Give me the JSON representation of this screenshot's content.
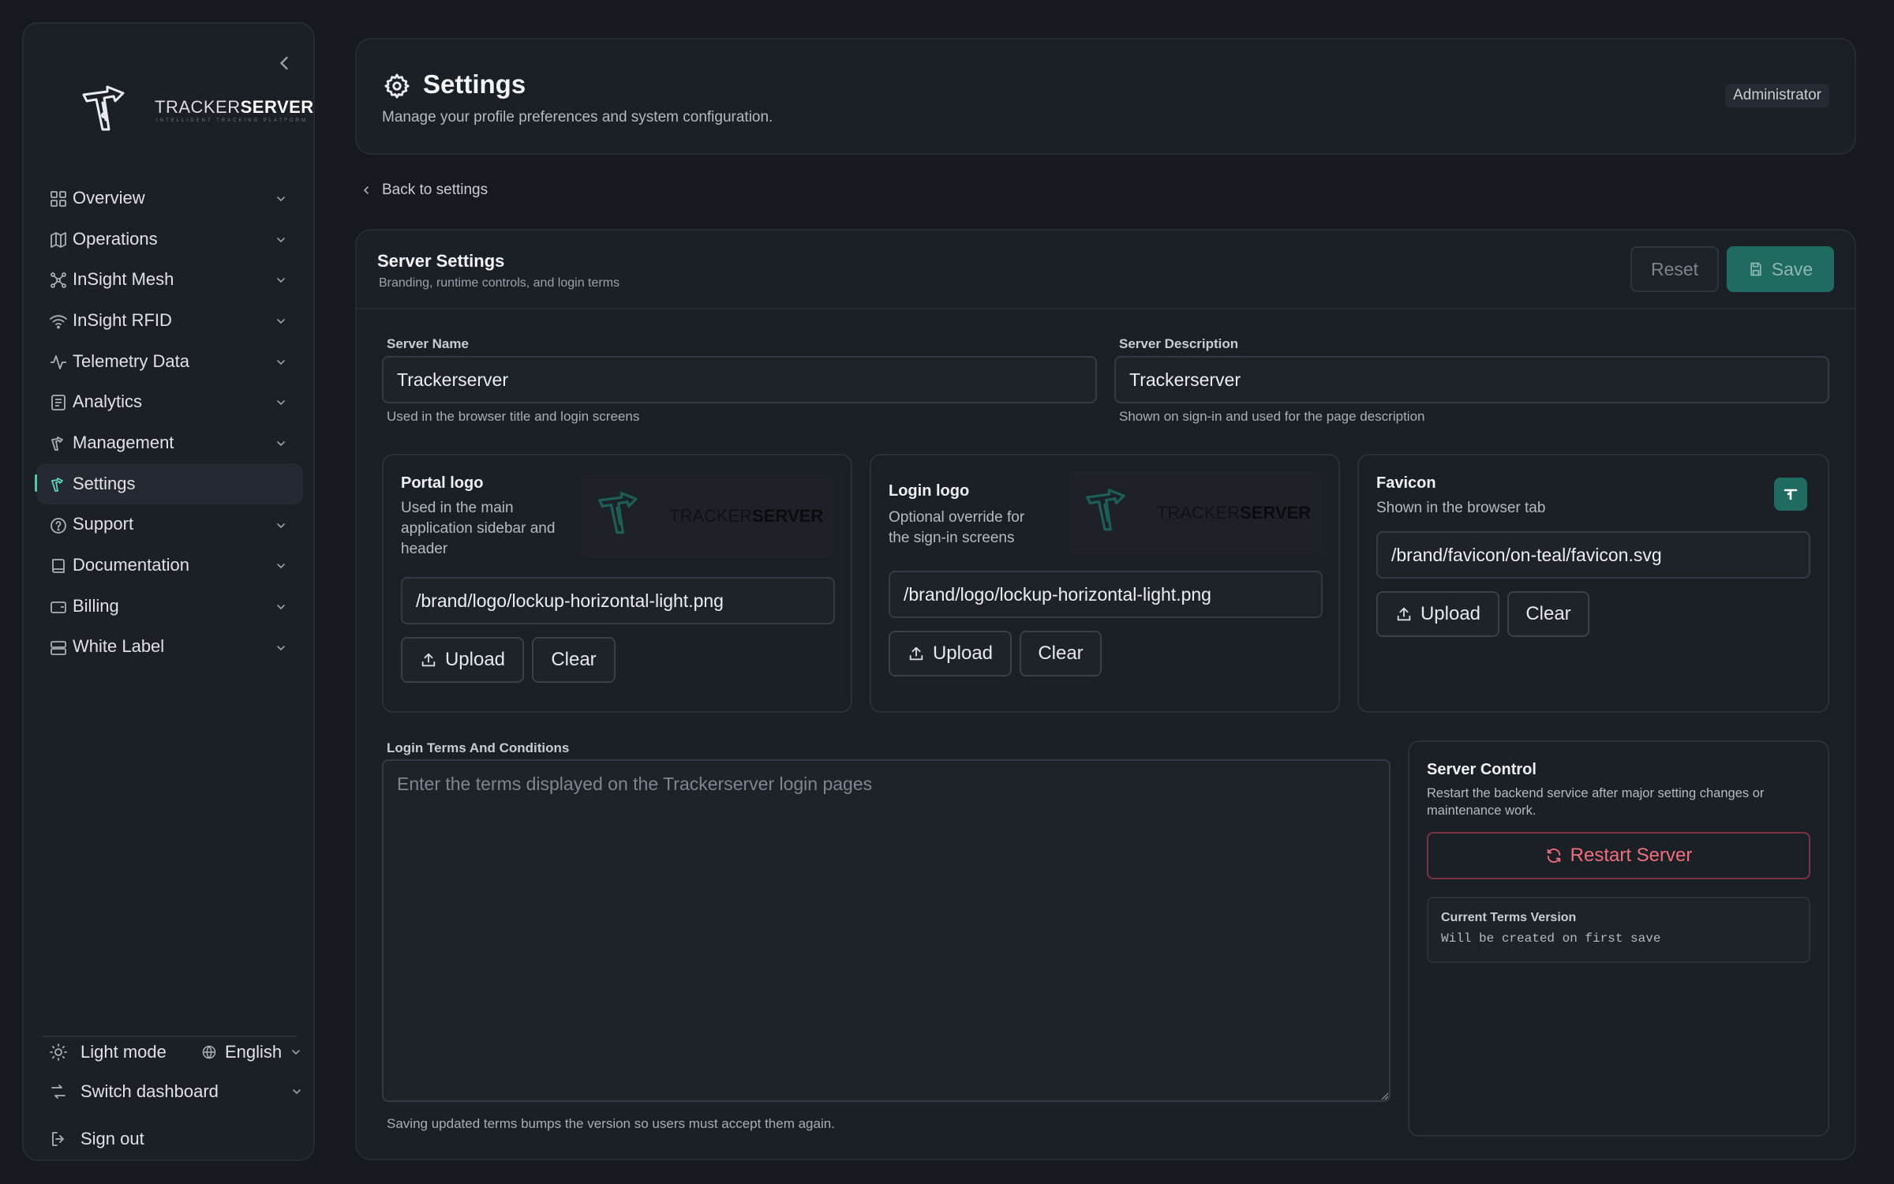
{
  "brand": {
    "name_light": "TRACKER",
    "name_bold": "SERVER",
    "tagline": "INTELLIGENT TRACKING PLATFORM",
    "accent": "#1f6b62"
  },
  "sidebar": {
    "items": [
      {
        "label": "Overview",
        "icon": "grid-icon"
      },
      {
        "label": "Operations",
        "icon": "map-icon"
      },
      {
        "label": "InSight Mesh",
        "icon": "mesh-icon"
      },
      {
        "label": "InSight RFID",
        "icon": "rfid-icon"
      },
      {
        "label": "Telemetry Data",
        "icon": "pulse-icon"
      },
      {
        "label": "Analytics",
        "icon": "report-icon"
      },
      {
        "label": "Management",
        "icon": "management-icon"
      },
      {
        "label": "Settings",
        "icon": "settings-icon",
        "active": true
      },
      {
        "label": "Support",
        "icon": "help-icon"
      },
      {
        "label": "Documentation",
        "icon": "book-icon"
      },
      {
        "label": "Billing",
        "icon": "wallet-icon"
      },
      {
        "label": "White Label",
        "icon": "server-icon"
      }
    ],
    "footer": {
      "light_mode": "Light mode",
      "language": "English",
      "switch_dashboard": "Switch dashboard",
      "sign_out": "Sign out"
    }
  },
  "header": {
    "title": "Settings",
    "subtitle": "Manage your profile preferences and system configuration.",
    "role": "Administrator"
  },
  "back_link": "Back to settings",
  "server_settings": {
    "title": "Server Settings",
    "subtitle": "Branding, runtime controls, and login terms",
    "reset_label": "Reset",
    "save_label": "Save",
    "server_name": {
      "label": "Server Name",
      "value": "Trackerserver",
      "help": "Used in the browser title and login screens"
    },
    "server_description": {
      "label": "Server Description",
      "value": "Trackerserver",
      "help": "Shown on sign-in and used for the page description"
    },
    "portal_logo": {
      "title": "Portal logo",
      "description": "Used in the main application sidebar and header",
      "path": "/brand/logo/lockup-horizontal-light.png",
      "upload_label": "Upload",
      "clear_label": "Clear"
    },
    "login_logo": {
      "title": "Login logo",
      "description": "Optional override for the sign-in screens",
      "path": "/brand/logo/lockup-horizontal-light.png",
      "upload_label": "Upload",
      "clear_label": "Clear"
    },
    "favicon": {
      "title": "Favicon",
      "description": "Shown in the browser tab",
      "path": "/brand/favicon/on-teal/favicon.svg",
      "upload_label": "Upload",
      "clear_label": "Clear"
    },
    "login_terms": {
      "label": "Login Terms And Conditions",
      "placeholder": "Enter the terms displayed on the Trackerserver login pages",
      "value": "",
      "help": "Saving updated terms bumps the version so users must accept them again."
    },
    "server_control": {
      "title": "Server Control",
      "description": "Restart the backend service after major setting changes or maintenance work.",
      "restart_label": "Restart Server",
      "terms_version_label": "Current Terms Version",
      "terms_version_value": "Will be created on first save"
    }
  }
}
